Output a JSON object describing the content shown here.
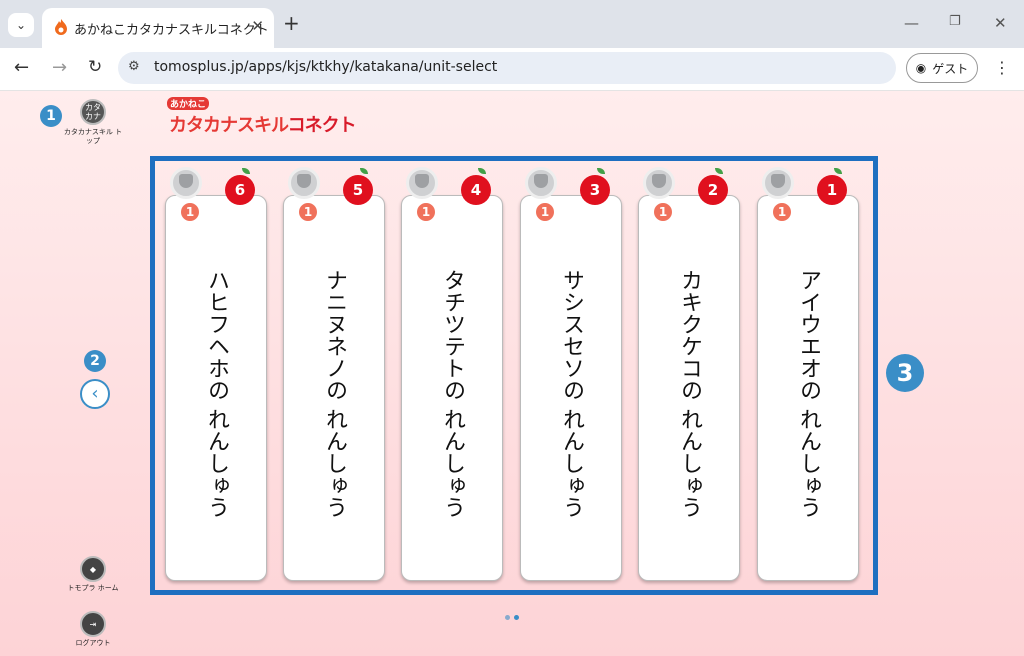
{
  "browser": {
    "tab_title": "あかねこカタカナスキルコネクト",
    "url": "tomosplus.jp/apps/kjs/ktkhy/katakana/unit-select",
    "profile_label": "ゲスト",
    "newtab_label": "+",
    "close_label": "✕"
  },
  "app": {
    "logo_small": "あかねこ",
    "logo_main": "カタカナスキル",
    "logo_accent": "コネクト",
    "top_button_icon": "カタ カナ",
    "top_button_label": "カタカナスキル トップ",
    "home_label": "トモプラ ホーム",
    "logout_label": "ログアウト",
    "markers": [
      "1",
      "2",
      "3"
    ]
  },
  "units": [
    {
      "label": "ハヒフヘホの れんしゅう",
      "apples": "6",
      "level": "1"
    },
    {
      "label": "ナニヌネノの れんしゅう",
      "apples": "5",
      "level": "1"
    },
    {
      "label": "タチツテトの れんしゅう",
      "apples": "4",
      "level": "1"
    },
    {
      "label": "サシスセソの れんしゅう",
      "apples": "3",
      "level": "1"
    },
    {
      "label": "カキクケコの れんしゅう",
      "apples": "2",
      "level": "1"
    },
    {
      "label": "アイウエオの れんしゅう",
      "apples": "1",
      "level": "1"
    }
  ],
  "colors": {
    "accent": "#3a8ec7",
    "board": "#1e6fc0",
    "apple": "#e0101e",
    "badge": "#f0715b"
  }
}
